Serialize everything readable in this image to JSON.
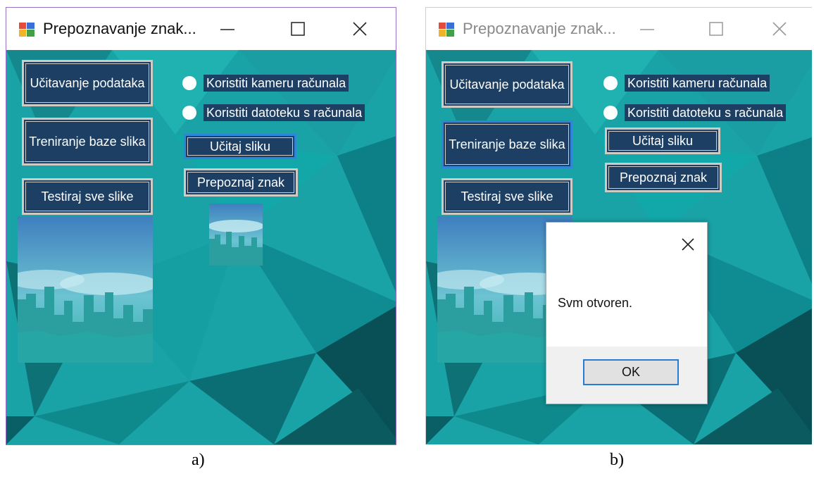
{
  "window_a": {
    "title": "Prepoznavanje znak...",
    "buttons": {
      "load_data": "Učitavanje podataka",
      "train": "Treniranje baze slika",
      "test_all": "Testiraj sve slike",
      "load_image": "Učitaj sliku",
      "recognize": "Prepoznaj znak"
    },
    "radios": {
      "camera": "Koristiti kameru računala",
      "file": "Koristiti datoteku s računala"
    }
  },
  "window_b": {
    "title": "Prepoznavanje znak...",
    "buttons": {
      "load_data": "Učitavanje podataka",
      "train": "Treniranje baze slika",
      "test_all": "Testiraj sve slike",
      "load_image": "Učitaj sliku",
      "recognize": "Prepoznaj znak"
    },
    "radios": {
      "camera": "Koristiti kameru računala",
      "file": "Koristiti datoteku s računala"
    },
    "message_box": {
      "message": "Svm otvoren.",
      "ok_label": "OK"
    }
  },
  "captions": {
    "a": "a)",
    "b": "b)"
  },
  "icons": [
    "app-icon",
    "minimize-icon",
    "maximize-icon",
    "close-icon"
  ],
  "colors": {
    "button_bg": "#1c3f63",
    "button_border": "#cfcac4",
    "focus_border": "#2f86d8",
    "background_teal": "#1aa3a6"
  }
}
